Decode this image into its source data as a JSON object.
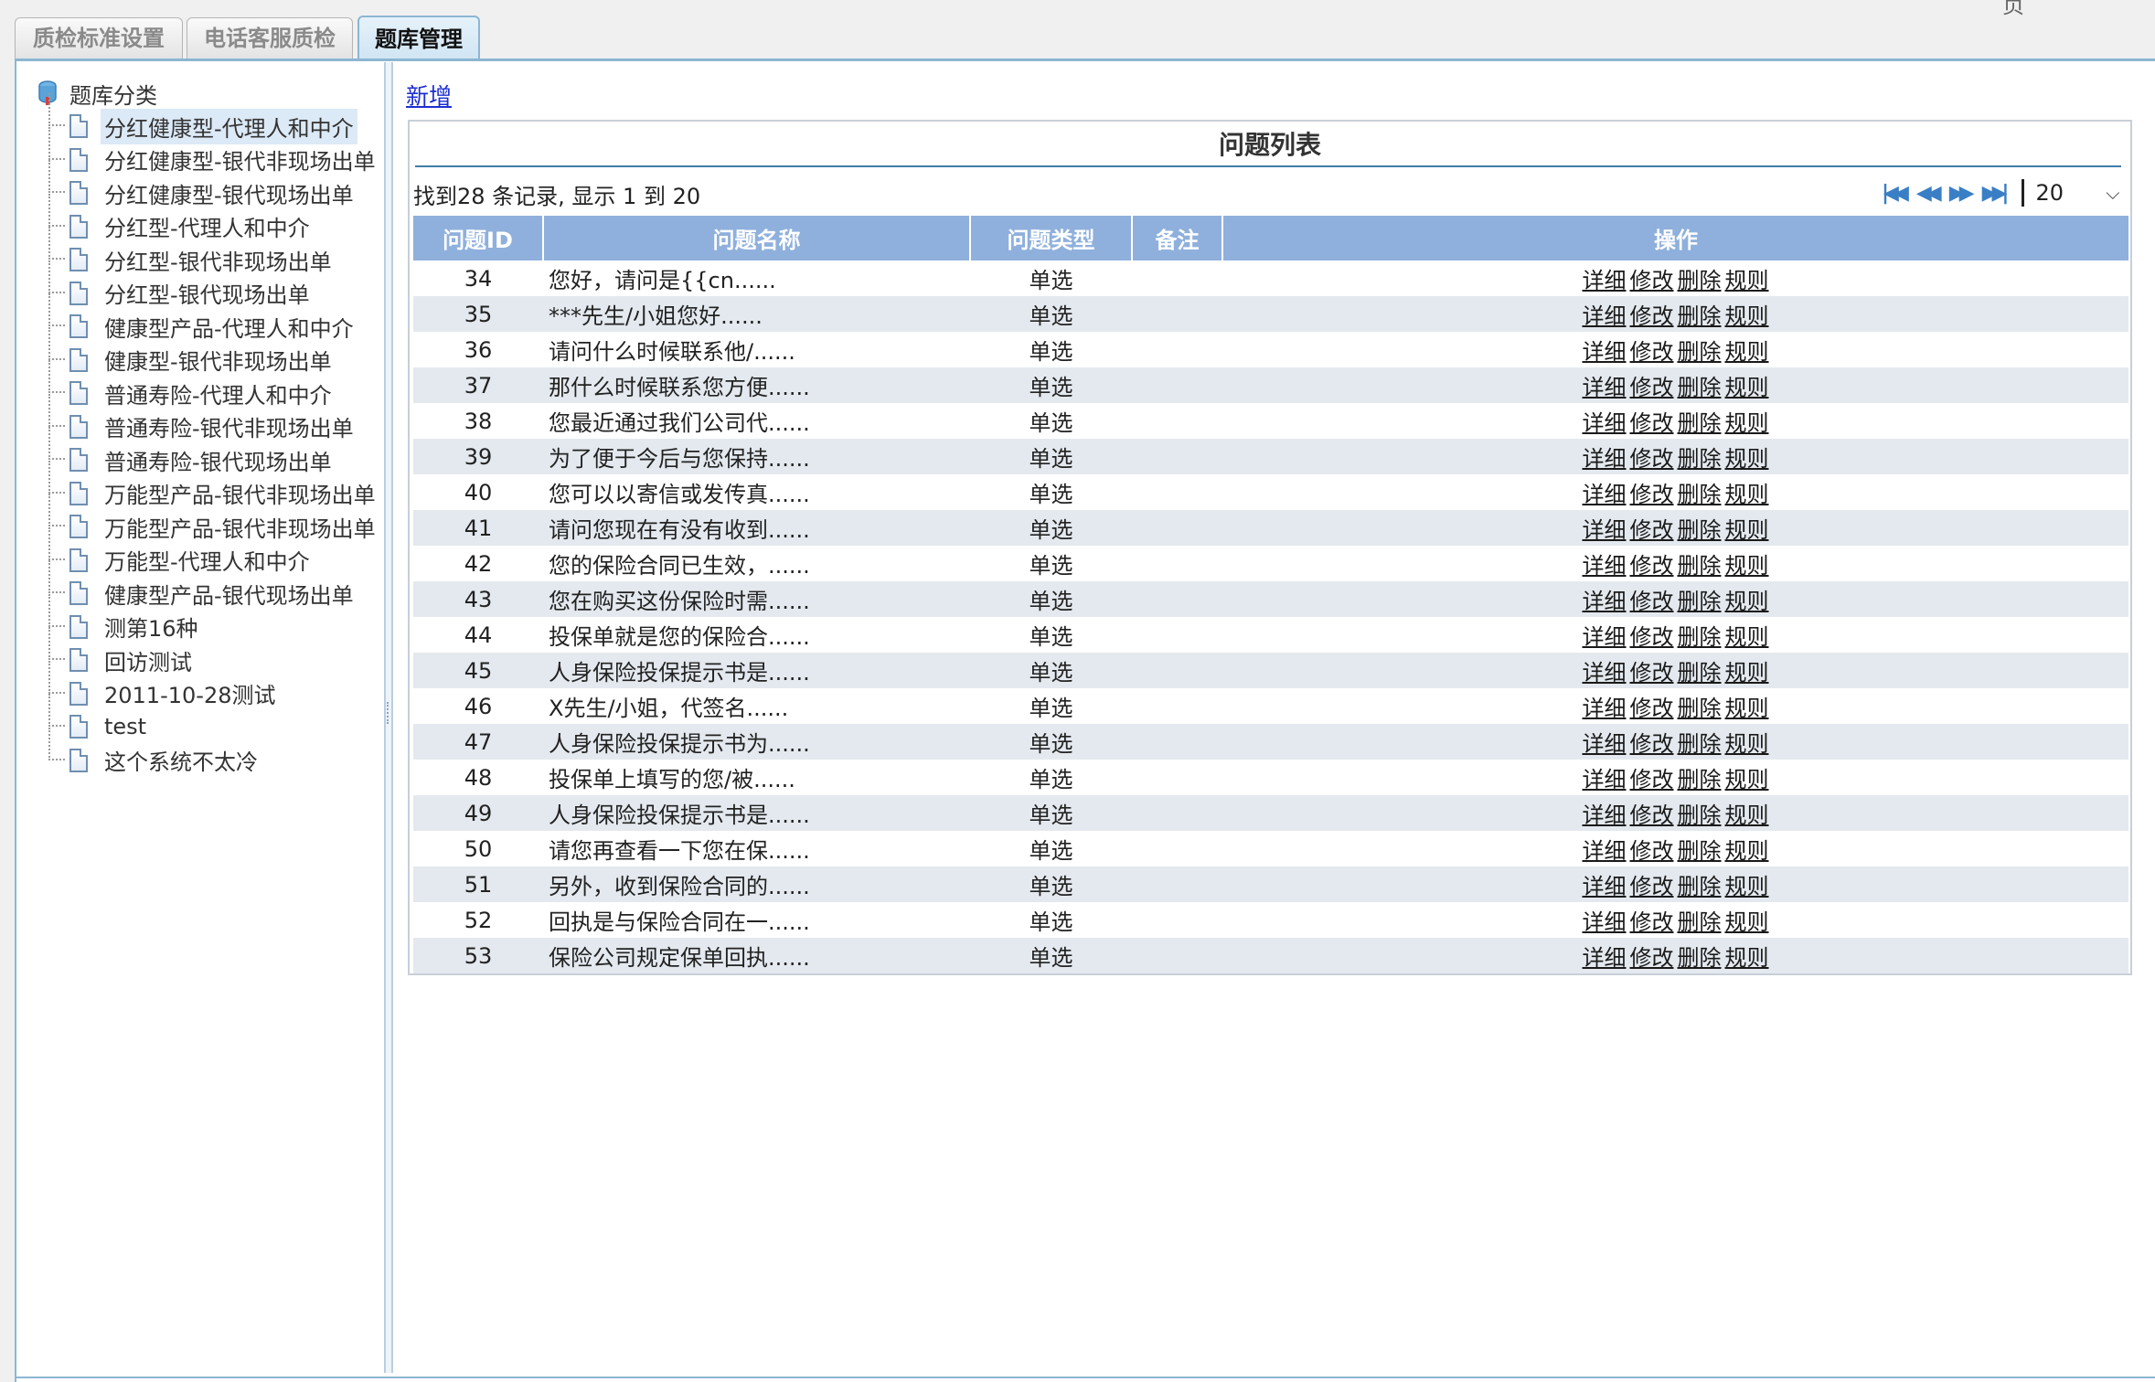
{
  "corner_text": "页",
  "tabs": [
    {
      "label": "质检标准设置",
      "active": false
    },
    {
      "label": "电话客服质检",
      "active": false
    },
    {
      "label": "题库管理",
      "active": true
    }
  ],
  "tree": {
    "root_label": "题库分类",
    "items": [
      "分红健康型-代理人和中介",
      "分红健康型-银代非现场出单",
      "分红健康型-银代现场出单",
      "分红型-代理人和中介",
      "分红型-银代非现场出单",
      "分红型-银代现场出单",
      "健康型产品-代理人和中介",
      "健康型-银代非现场出单",
      "普通寿险-代理人和中介",
      "普通寿险-银代非现场出单",
      "普通寿险-银代现场出单",
      "万能型产品-银代非现场出单",
      "万能型产品-银代非现场出单",
      "万能型-代理人和中介",
      "健康型产品-银代现场出单",
      "测第16种",
      "回访测试",
      "2011-10-28测试",
      "test",
      "这个系统不太冷"
    ],
    "selected_index": 0
  },
  "main": {
    "add_label": "新增",
    "grid_title": "问题列表",
    "record_info": "找到28 条记录, 显示 1 到 20",
    "page_size": "20",
    "columns": [
      "问题ID",
      "问题名称",
      "问题类型",
      "备注",
      "操作"
    ],
    "ops": [
      "详细",
      "修改",
      "删除",
      "规则"
    ],
    "rows": [
      {
        "id": "34",
        "name": "您好，请问是{{cn......",
        "type": "单选",
        "note": ""
      },
      {
        "id": "35",
        "name": "***先生/小姐您好......",
        "type": "单选",
        "note": ""
      },
      {
        "id": "36",
        "name": "请问什么时候联系他/......",
        "type": "单选",
        "note": ""
      },
      {
        "id": "37",
        "name": "那什么时候联系您方便......",
        "type": "单选",
        "note": ""
      },
      {
        "id": "38",
        "name": "您最近通过我们公司代......",
        "type": "单选",
        "note": ""
      },
      {
        "id": "39",
        "name": "为了便于今后与您保持......",
        "type": "单选",
        "note": ""
      },
      {
        "id": "40",
        "name": "您可以以寄信或发传真......",
        "type": "单选",
        "note": ""
      },
      {
        "id": "41",
        "name": "请问您现在有没有收到......",
        "type": "单选",
        "note": ""
      },
      {
        "id": "42",
        "name": "您的保险合同已生效，......",
        "type": "单选",
        "note": ""
      },
      {
        "id": "43",
        "name": "您在购买这份保险时需......",
        "type": "单选",
        "note": ""
      },
      {
        "id": "44",
        "name": "投保单就是您的保险合......",
        "type": "单选",
        "note": ""
      },
      {
        "id": "45",
        "name": "人身保险投保提示书是......",
        "type": "单选",
        "note": ""
      },
      {
        "id": "46",
        "name": "X先生/小姐，代签名......",
        "type": "单选",
        "note": ""
      },
      {
        "id": "47",
        "name": "人身保险投保提示书为......",
        "type": "单选",
        "note": ""
      },
      {
        "id": "48",
        "name": "投保单上填写的您/被......",
        "type": "单选",
        "note": ""
      },
      {
        "id": "49",
        "name": "人身保险投保提示书是......",
        "type": "单选",
        "note": ""
      },
      {
        "id": "50",
        "name": "请您再查看一下您在保......",
        "type": "单选",
        "note": ""
      },
      {
        "id": "51",
        "name": "另外，收到保险合同的......",
        "type": "单选",
        "note": ""
      },
      {
        "id": "52",
        "name": "回执是与保险合同在一......",
        "type": "单选",
        "note": ""
      },
      {
        "id": "53",
        "name": "保险公司规定保单回执......",
        "type": "单选",
        "note": ""
      }
    ]
  },
  "colors": {
    "accent": "#8cb6d2",
    "header_bg": "#8fb0dc",
    "row_alt": "#e4e9ef",
    "link": "#1d2ed1",
    "pager_icon": "#3a7fc6"
  }
}
